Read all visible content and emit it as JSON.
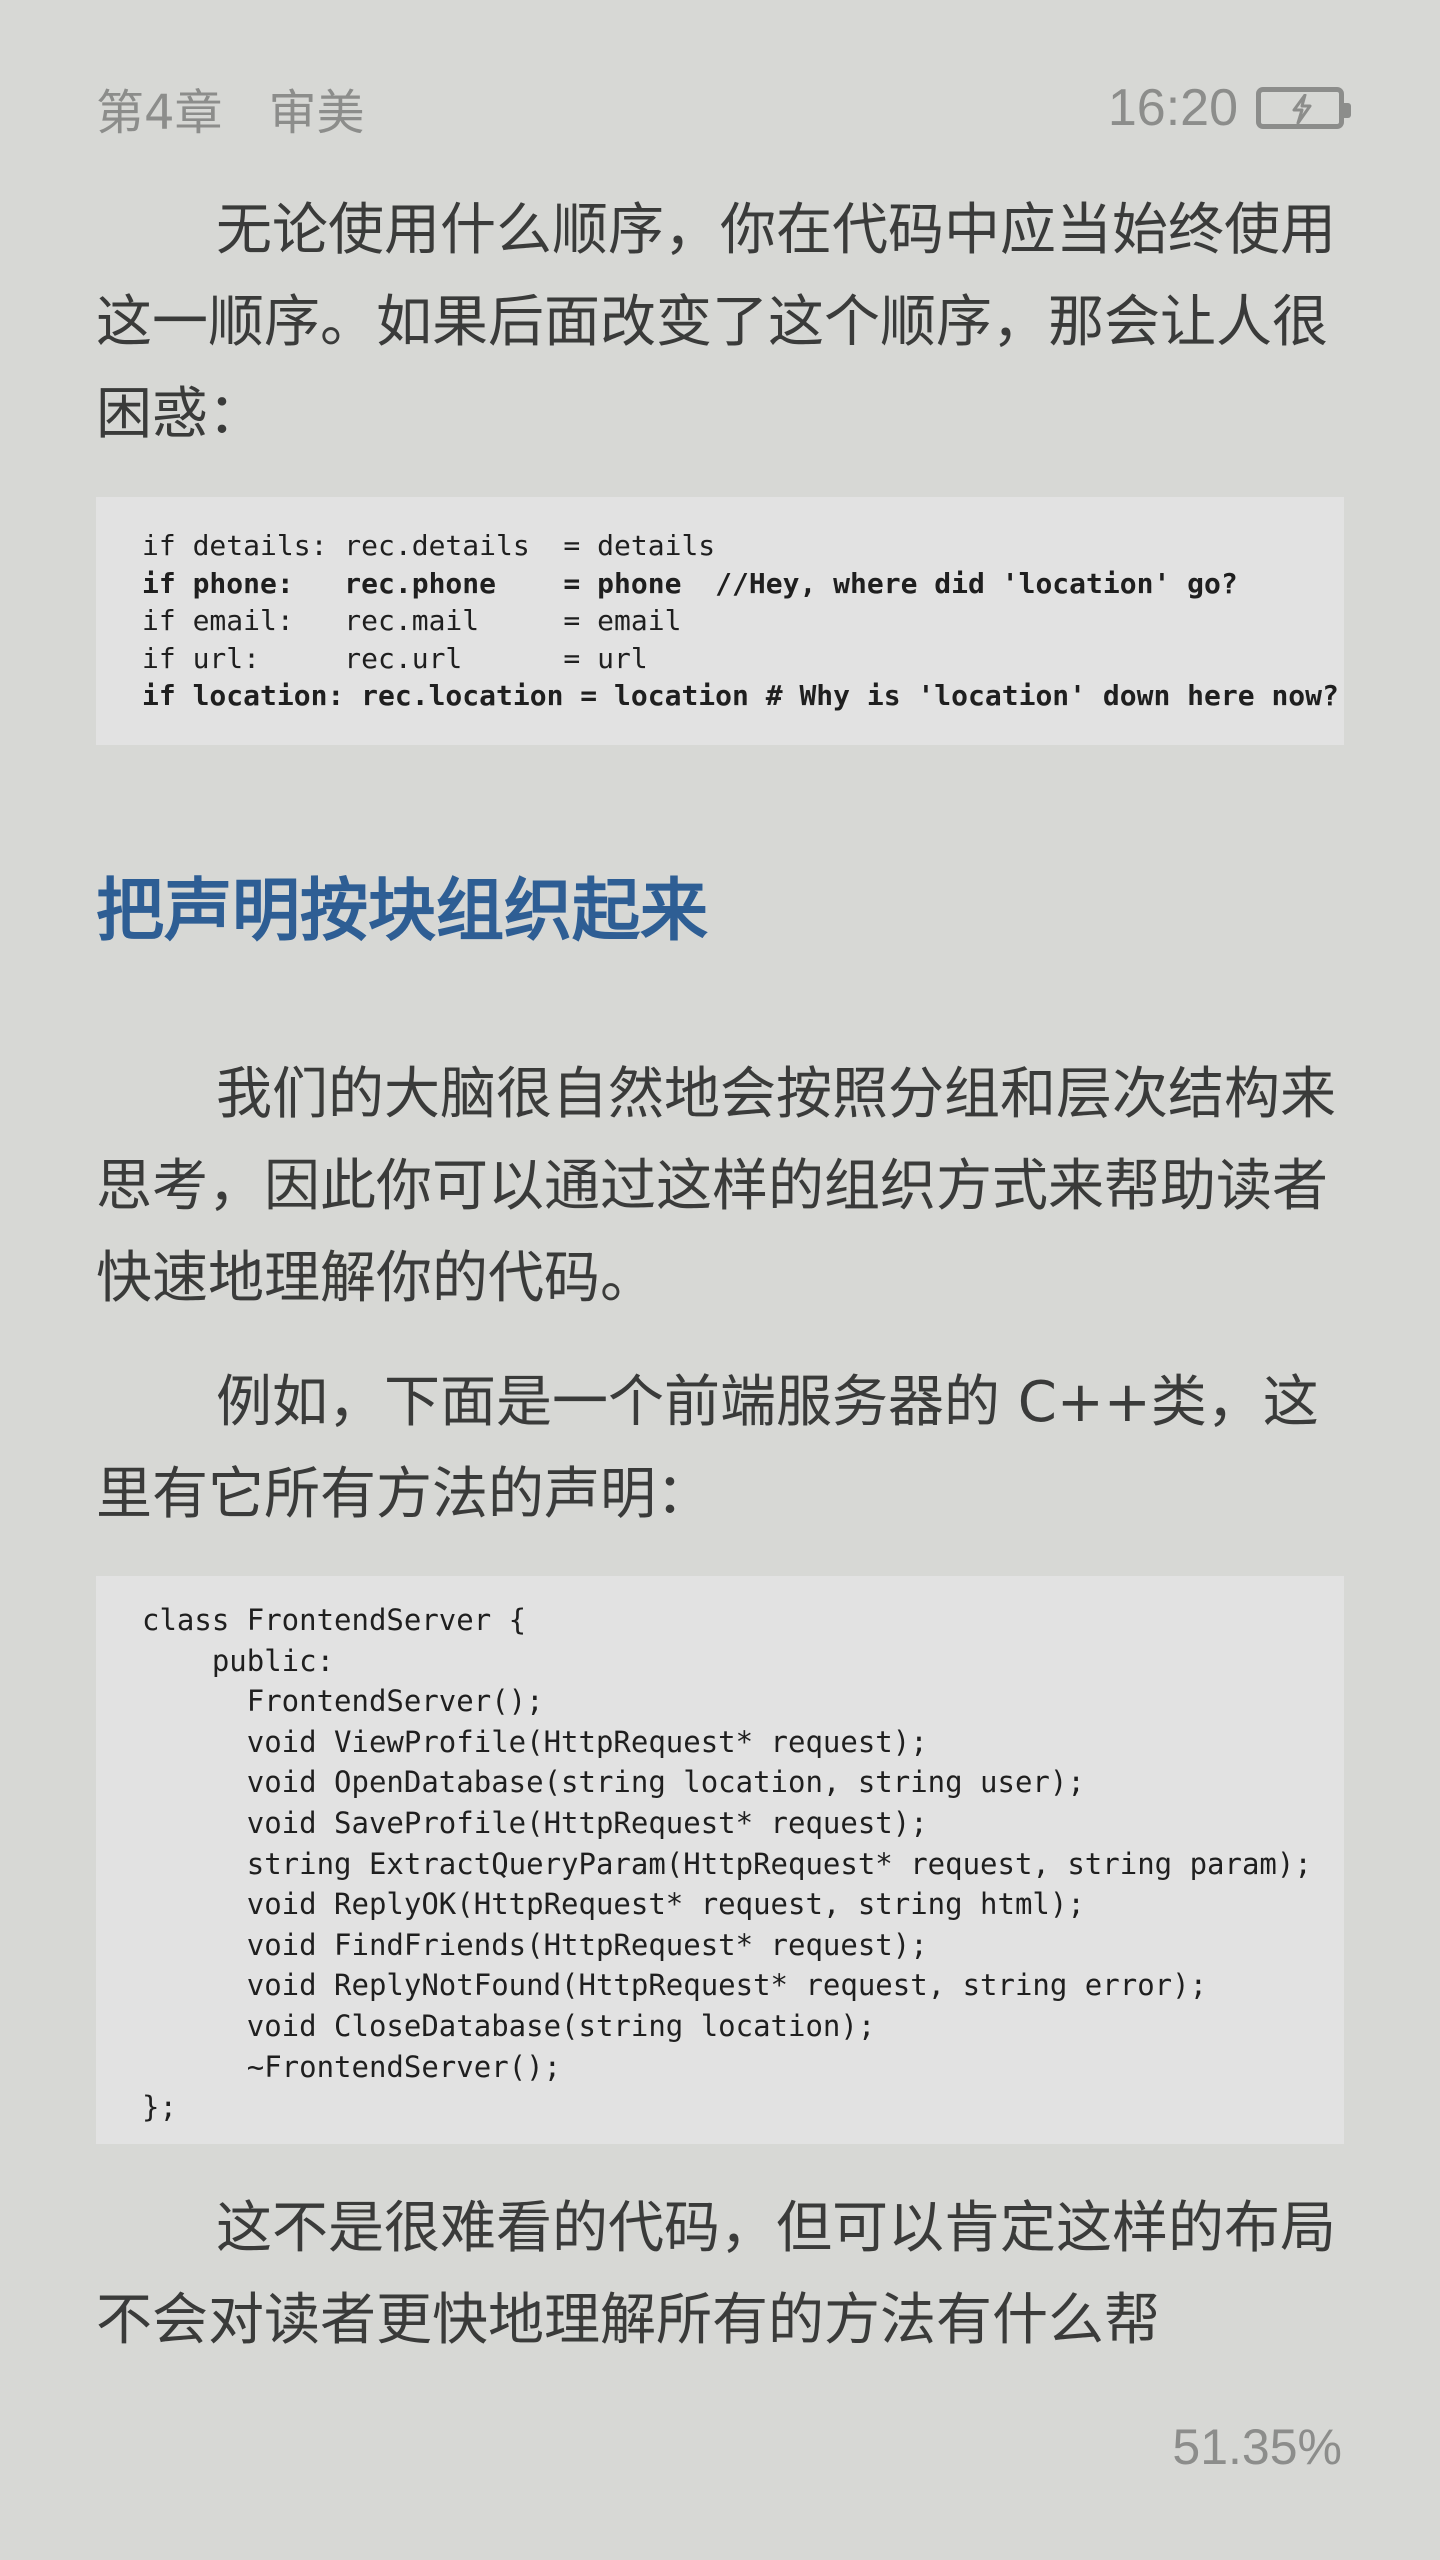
{
  "status_bar": {
    "chapter": "第4章",
    "section": "审美",
    "time": "16:20",
    "battery_icon": "battery-charging-icon"
  },
  "paragraphs": {
    "p1": "无论使用什么顺序，你在代码中应当始终使用这一顺序。如果后面改变了这个顺序，那会让人很困惑：",
    "p2": "我们的大脑很自然地会按照分组和层次结构来思考，因此你可以通过这样的组织方式来帮助读者快速地理解你的代码。",
    "p3": "例如，下面是一个前端服务器的 C++类，这里有它所有方法的声明：",
    "p4": "这不是很难看的代码，但可以肯定这样的布局不会对读者更快地理解所有的方法有什么帮"
  },
  "code_block_1": [
    "if details: rec.details  = details",
    "if phone:   rec.phone    = phone  //Hey, where did 'location' go?",
    "if email:   rec.mail     = email",
    "if url:     rec.url      = url",
    "if location: rec.location = location # Why is 'location' down here now?"
  ],
  "heading": "把声明按块组织起来",
  "code_block_2": [
    "class FrontendServer {",
    "    public:",
    "      FrontendServer();",
    "      void ViewProfile(HttpRequest* request);",
    "      void OpenDatabase(string location, string user);",
    "      void SaveProfile(HttpRequest* request);",
    "      string ExtractQueryParam(HttpRequest* request, string param);",
    "      void ReplyOK(HttpRequest* request, string html);",
    "      void FindFriends(HttpRequest* request);",
    "      void ReplyNotFound(HttpRequest* request, string error);",
    "      void CloseDatabase(string location);",
    "      ~FrontendServer();",
    "};"
  ],
  "reading_progress": "51.35%"
}
